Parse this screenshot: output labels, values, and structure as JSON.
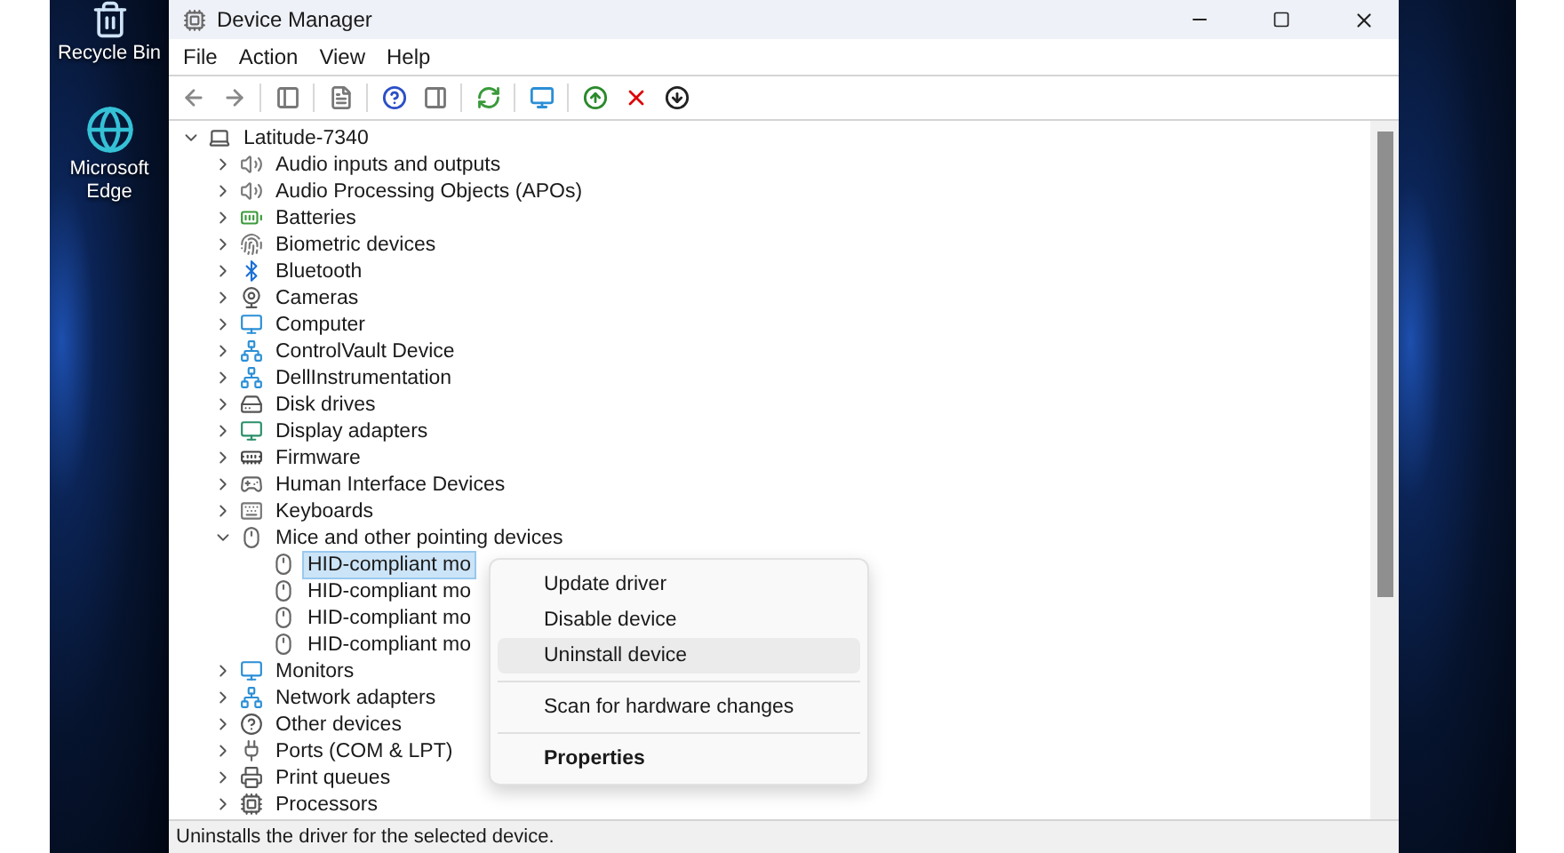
{
  "window": {
    "title": "Device Manager"
  },
  "desktop_icons": [
    {
      "label": "Recycle Bin"
    },
    {
      "label": "Microsoft Edge"
    }
  ],
  "menu_bar": [
    "File",
    "Action",
    "View",
    "Help"
  ],
  "tree": [
    {
      "label": "Latitude-7340",
      "expanded": true,
      "selected": false,
      "children": [
        {
          "label": "Audio inputs and outputs",
          "expanded": false,
          "selected": false
        },
        {
          "label": "Audio Processing Objects (APOs)",
          "expanded": false,
          "selected": false
        },
        {
          "label": "Batteries",
          "expanded": false,
          "selected": false
        },
        {
          "label": "Biometric devices",
          "expanded": false,
          "selected": false
        },
        {
          "label": "Bluetooth",
          "expanded": false,
          "selected": false
        },
        {
          "label": "Cameras",
          "expanded": false,
          "selected": false
        },
        {
          "label": "Computer",
          "expanded": false,
          "selected": false
        },
        {
          "label": "ControlVault Device",
          "expanded": false,
          "selected": false
        },
        {
          "label": "DellInstrumentation",
          "expanded": false,
          "selected": false
        },
        {
          "label": "Disk drives",
          "expanded": false,
          "selected": false
        },
        {
          "label": "Display adapters",
          "expanded": false,
          "selected": false
        },
        {
          "label": "Firmware",
          "expanded": false,
          "selected": false
        },
        {
          "label": "Human Interface Devices",
          "expanded": false,
          "selected": false
        },
        {
          "label": "Keyboards",
          "expanded": false,
          "selected": false
        },
        {
          "label": "Mice and other pointing devices",
          "expanded": true,
          "selected": false,
          "children": [
            {
              "label": "HID-compliant mo",
              "selected": true
            },
            {
              "label": "HID-compliant mo",
              "selected": false
            },
            {
              "label": "HID-compliant mo",
              "selected": false
            },
            {
              "label": "HID-compliant mo",
              "selected": false
            }
          ]
        },
        {
          "label": "Monitors",
          "expanded": false,
          "selected": false
        },
        {
          "label": "Network adapters",
          "expanded": false,
          "selected": false
        },
        {
          "label": "Other devices",
          "expanded": false,
          "selected": false
        },
        {
          "label": "Ports (COM & LPT)",
          "expanded": false,
          "selected": false
        },
        {
          "label": "Print queues",
          "expanded": false,
          "selected": false
        },
        {
          "label": "Processors",
          "expanded": false,
          "selected": false
        }
      ]
    }
  ],
  "context_menu": {
    "groups": [
      [
        {
          "label": "Update driver",
          "selected": false,
          "bold": false
        },
        {
          "label": "Disable device",
          "selected": false,
          "bold": false
        },
        {
          "label": "Uninstall device",
          "selected": true,
          "bold": false
        }
      ],
      [
        {
          "label": "Scan for hardware changes",
          "selected": false,
          "bold": false
        }
      ],
      [
        {
          "label": "Properties",
          "selected": false,
          "bold": true
        }
      ]
    ]
  },
  "status_bar": "Uninstalls the driver for the selected device."
}
